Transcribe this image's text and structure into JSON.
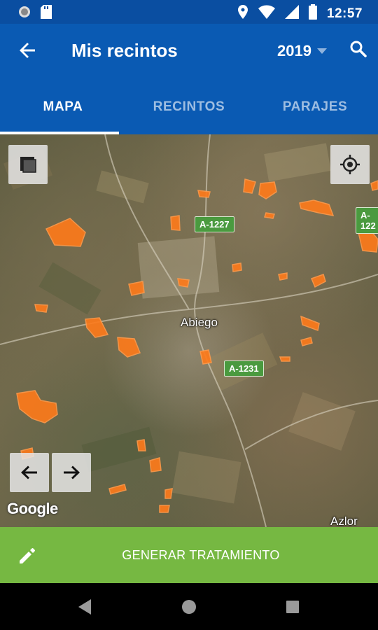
{
  "status_bar": {
    "time": "12:57"
  },
  "app_bar": {
    "title": "Mis recintos",
    "year": "2019"
  },
  "tabs": [
    {
      "label": "MAPA",
      "active": true
    },
    {
      "label": "RECINTOS",
      "active": false
    },
    {
      "label": "PARAJES",
      "active": false
    }
  ],
  "map": {
    "road_labels": [
      "A-1227",
      "A-122",
      "A-1231"
    ],
    "place_labels": [
      "Abiego",
      "Azlor"
    ],
    "attribution": "Google",
    "parcel_color": "#ff7a1a"
  },
  "action_bar": {
    "label": "GENERAR TRATAMIENTO"
  },
  "colors": {
    "primary": "#0a5ab3",
    "status": "#0a4ea1",
    "action": "#76b842"
  }
}
